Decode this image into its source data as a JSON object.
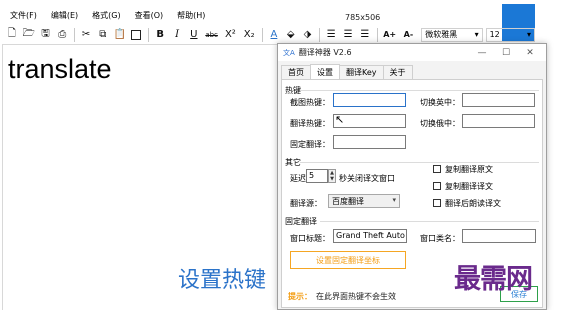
{
  "editor": {
    "menu": [
      "文件(F)",
      "编辑(E)",
      "格式(G)",
      "查看(O)",
      "帮助(H)"
    ],
    "window_size": "785x506",
    "toolbar": {
      "bold": "B",
      "italic": "I",
      "underline": "U",
      "strike": "abc",
      "superscript": "X²",
      "subscript": "X₂",
      "font_color": "A",
      "grow_font": "A+",
      "shrink_font": "A-",
      "font_name": "微软雅黑",
      "font_size": "12"
    },
    "document_text": "translate"
  },
  "dialog": {
    "title": "翻译神器 V2.6",
    "app_icon": "文A",
    "tabs": [
      "首页",
      "设置",
      "翻译Key",
      "关于"
    ],
    "active_tab": 1,
    "hotkey_group": {
      "title": "热键",
      "screenshot_hotkey": "截图热键：",
      "translate_hotkey": "翻译热键：",
      "fixed_translate": "固定翻译：",
      "switch_en_zh": "切换英中：",
      "switch_jp_zh": "切换俄中：",
      "screenshot_value": "",
      "translate_value": "",
      "fixed_value": "",
      "en_zh_value": "",
      "jp_zh_value": ""
    },
    "other_group": {
      "title": "其它",
      "delay_label": "延迟",
      "delay_value": "5",
      "delay_suffix": "秒关闭译文窗口",
      "source_label": "翻译源：",
      "source_value": "百度翻译",
      "copy_source": "复制翻译原文",
      "copy_result": "复制翻译译文",
      "read_after": "翻译后朗读译文"
    },
    "fixed_group": {
      "title": "固定翻译",
      "window_title_label": "窗口标题：",
      "window_title_value": "Grand Theft Auto",
      "window_class_label": "窗口类名：",
      "window_class_value": "",
      "set_coords_button": "设置固定翻译坐标"
    },
    "hint_label": "提示：",
    "hint_text": "在此界面热键不会生效",
    "save_button": "保存"
  },
  "caption": "设置热键",
  "watermark": "最需网",
  "colors": {
    "accent": "#2a73c9",
    "orange": "#f39c12",
    "watermark": "#6a2a8c"
  }
}
